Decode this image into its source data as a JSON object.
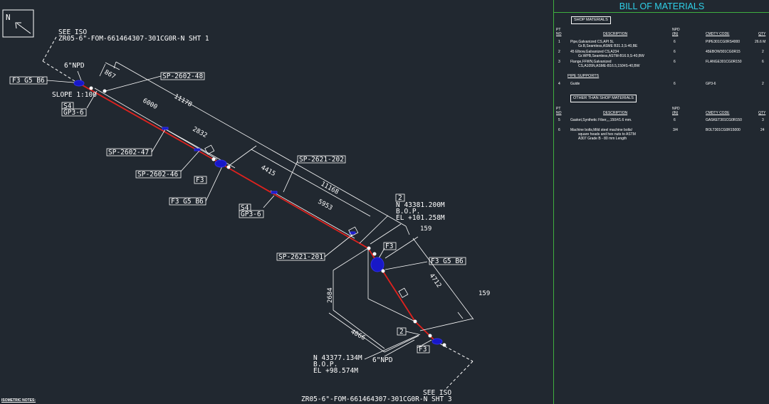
{
  "drawing": {
    "north": "N",
    "see_iso_top": {
      "label": "SEE ISO",
      "ref": "ZR05-6\"-FOM-661464307-301CG0R-N SHT 1"
    },
    "see_iso_bottom": {
      "label": "SEE ISO",
      "ref": "ZR05-6\"-FOM-661464307-301CG0R-N SHT 3"
    },
    "npd_top": "6\"NPD",
    "npd_bottom": "6\"NPD",
    "slope": "SLOPE 1:100",
    "tags": {
      "f3g5b6_a": "F3 G5 B6",
      "s4_a": "S4",
      "gp36_a": "GP3-6",
      "sp2602_48": "SP-2602-48",
      "sp2602_47": "SP-2602-47",
      "sp2602_46": "SP-2602-46",
      "f3_a": "F3",
      "f3g5b6_b": "F3 G5 B6",
      "sp2621_202": "SP-2621-202",
      "s4_b": "S4",
      "gp36_b": "GP3-6",
      "sp2621_201": "SP-2621-201",
      "f3_b": "F3",
      "f3g5b6_c": "F3 G5 B6",
      "two_a": "2",
      "two_b": "2",
      "f3_c": "F3"
    },
    "dims": {
      "d867": "867",
      "d6000": "6000",
      "d11178": "11178",
      "d2832": "2832",
      "d4415": "4415",
      "d11168": "11168",
      "d5953": "5953",
      "d159a": "159",
      "d4712": "4712",
      "d159b": "159",
      "d2684": "2684",
      "d4066": "4066"
    },
    "bop_top": {
      "n": "N 43381.200M",
      "bop": "B.O.P.",
      "el": "EL +101.258M"
    },
    "bop_bottom": {
      "n": "N 43377.134M",
      "bop": "B.O.P.",
      "el": "EL +98.574M"
    },
    "notes": "ISOMETRIC NOTES:"
  },
  "bom": {
    "title": "BILL OF MATERIALS",
    "shop_materials": "SHOP MATERIALS",
    "other_materials": "OTHER THAN SHOP MATERIALS",
    "pipe_supports": "PIPE SUPPORTS",
    "headers": {
      "pt": "PT",
      "no": "NO",
      "desc": "DESCRIPTION",
      "npd": "NPD",
      "in": "(IN)",
      "code": "CMDTY CODE",
      "qty": "QTY"
    },
    "items": [
      {
        "pt": "1",
        "desc1": "Pipe,Galvanized CS,API 5L",
        "desc2": "Gr.B,Seamless,ASME B31.3,S-40,BE",
        "npd": "6",
        "code": "PIPE301CG0RS4000",
        "qty": "26.6 M"
      },
      {
        "pt": "2",
        "desc1": "45 Elbow,Galvanized CS,A234",
        "desc2": "Gr.WPB,Seamless,ASTM-B16.9,S-40,BW",
        "npd": "6",
        "code": "45EBOW301CG0R15",
        "qty": "2"
      },
      {
        "pt": "3",
        "desc1": "Flange,FFWN,Galvanized",
        "desc2": "CS,A105N,ASME-B16.5,150#S-40,BW",
        "npd": "6",
        "code": "FLANGE301CG0R150",
        "qty": "6"
      },
      {
        "pt": "4",
        "desc1": "Guide",
        "desc2": "",
        "npd": "6",
        "code": "GP3-6",
        "qty": "2"
      },
      {
        "pt": "5",
        "desc1": "Gasket,Synthetic Fiber,,,,150#/1.6 mm.",
        "desc2": "",
        "npd": "6",
        "code": "GASKET301CG0R150",
        "qty": "3"
      },
      {
        "pt": "6",
        "desc1": "Machine bolts,Mild steel machine bolts/",
        "desc2": "square heads and hex nuts to ASTM",
        "desc3": "A307 Grade B - 80 mm Length",
        "npd": "3/4",
        "code": "BOLT301CG0R15000",
        "qty": "24"
      }
    ]
  }
}
